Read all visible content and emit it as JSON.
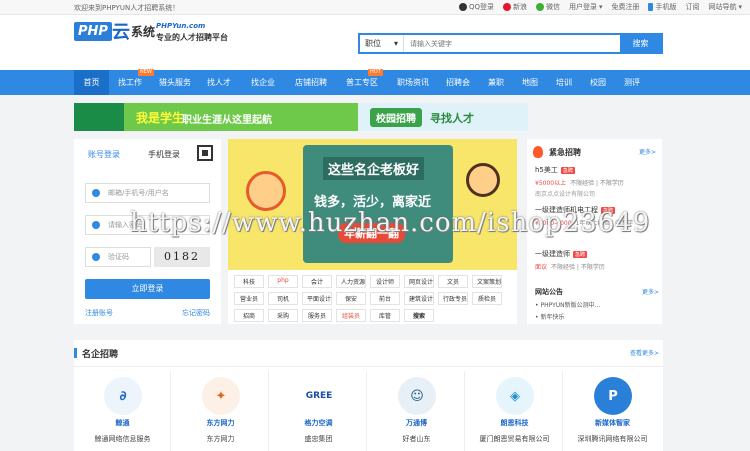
{
  "topbar": {
    "welcome": "欢迎来到PHPYUN人才招聘系统！",
    "links": [
      "QQ登录",
      "新浪",
      "微信",
      "用户登录",
      "免费注册",
      "手机版",
      "订阅",
      "网站导航"
    ]
  },
  "logo": {
    "php": "PHP",
    "yun": "云",
    "sys": "系统",
    "url": "PHPYun.com",
    "slogan": "专业的人才招聘平台"
  },
  "search": {
    "type": "职位",
    "placeholder": "请输入关键字",
    "button": "搜索"
  },
  "nav": {
    "items": [
      "首页",
      "找工作",
      "猎头服务",
      "找人才",
      "找企业",
      "店铺招聘",
      "普工专区",
      "职场资讯",
      "招聘会",
      "兼职",
      "地图",
      "培训",
      "校园",
      "测评"
    ],
    "tag_new": "NEW",
    "tag_hot": "HOT"
  },
  "banner": {
    "left": "我是学生",
    "mid": "职业生涯从这里起航",
    "campus": "校园招聘",
    "find": "寻找人才"
  },
  "login": {
    "tab_account": "账号登录",
    "tab_phone": "手机登录",
    "user_placeholder": "邮箱/手机号/用户名",
    "pwd_placeholder": "请输入密码",
    "code_placeholder": "验证码",
    "captcha": "0182",
    "submit": "立即登录",
    "register": "注册账号",
    "forgot": "忘记密码"
  },
  "poster": {
    "title": "这些名企老板好",
    "sub": "钱多，活少，离家近",
    "btn": "年薪翻一翻"
  },
  "tags": [
    "科技",
    "php",
    "会计",
    "人力资源",
    "设计师",
    "网页设计",
    "文员",
    "文案策划",
    "营业员",
    "司机",
    "平面设计",
    "保安",
    "前台",
    "建筑设计",
    "行政专员",
    "质检员",
    "招商",
    "采购",
    "服务员",
    "组装员",
    "库管",
    "搜索"
  ],
  "urgent": {
    "title": "紧急招聘",
    "more": "更多>",
    "jobs": [
      {
        "name": "h5美工",
        "hot": "急聘",
        "salary": "¥5000以上",
        "req": "不限经验 | 不限学历",
        "company": "南京点点设计有限公司"
      },
      {
        "name": "一级建造师机电工程",
        "hot": "急聘",
        "salary": "¥3000-4000",
        "req": "1年以上经验 | 中专学",
        "company": ""
      },
      {
        "name": "一级建造师",
        "hot": "急聘",
        "salary": "面议",
        "req": "不限经验 | 不限学历",
        "company": ""
      }
    ]
  },
  "notice": {
    "title": "网站公告",
    "more": "更多>",
    "items": [
      "PHPYUN新版公测中...",
      "新年快乐"
    ]
  },
  "famous": {
    "title": "名企招聘",
    "more": "查看更多>",
    "companies": [
      {
        "logo": "鲸通",
        "name": "鲸通网络信息服务",
        "color": "#333"
      },
      {
        "logo": "东方网力",
        "name": "东方网力",
        "color": "#333"
      },
      {
        "logo": "格力空调",
        "name": "盛忠集团",
        "color": "#1a4ea8"
      },
      {
        "logo": "万通博",
        "name": "好者山东",
        "color": "#333"
      },
      {
        "logo": "朗恩科技",
        "name": "厦门朗恩贸易有限公司",
        "color": "#1a8fd0"
      },
      {
        "logo": "新媒体智家",
        "name": "深圳腾讯网络有限公司",
        "color": "#2a7fd8"
      }
    ]
  },
  "watermark": "https://www.huzhan.com/ishop23649"
}
